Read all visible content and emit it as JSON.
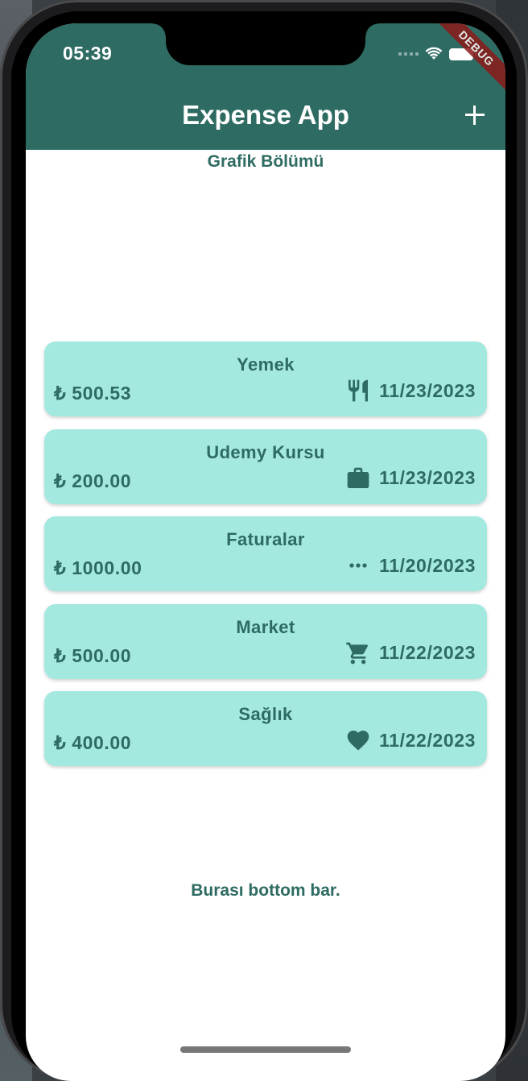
{
  "status_bar": {
    "time": "05:39"
  },
  "debug_banner": "DEBUG",
  "app_bar": {
    "title": "Expense App",
    "add_icon": "plus-icon"
  },
  "chart_section": {
    "title": "Grafik Bölümü"
  },
  "expenses": [
    {
      "title": "Yemek",
      "amount": "₺ 500.53",
      "date": "11/23/2023",
      "icon": "restaurant-icon"
    },
    {
      "title": "Udemy Kursu",
      "amount": "₺ 200.00",
      "date": "11/23/2023",
      "icon": "briefcase-icon"
    },
    {
      "title": "Faturalar",
      "amount": "₺ 1000.00",
      "date": "11/20/2023",
      "icon": "more-horiz-icon"
    },
    {
      "title": "Market",
      "amount": "₺ 500.00",
      "date": "11/22/2023",
      "icon": "shopping-cart-icon"
    },
    {
      "title": "Sağlık",
      "amount": "₺ 400.00",
      "date": "11/22/2023",
      "icon": "heart-icon"
    }
  ],
  "bottom_bar": {
    "text": "Burası bottom bar."
  },
  "colors": {
    "primary": "#2e6b62",
    "card": "#a4e9e0",
    "background": "#ffffff"
  }
}
